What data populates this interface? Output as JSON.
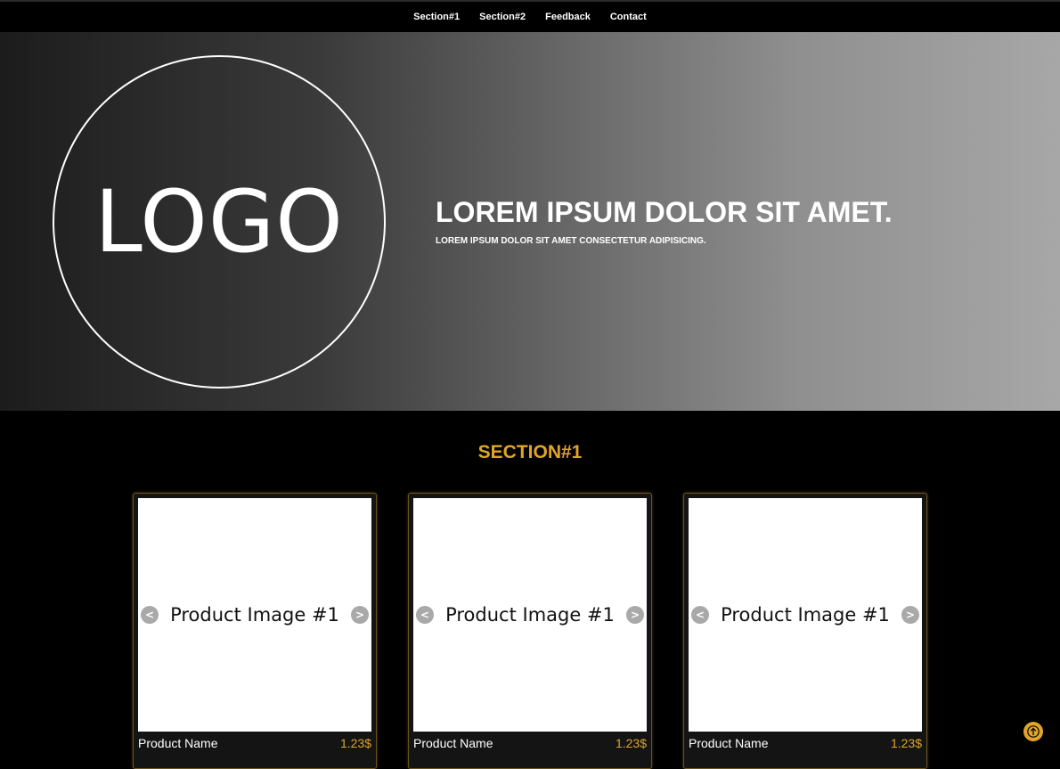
{
  "nav": {
    "items": [
      {
        "label": "Section#1"
      },
      {
        "label": "Section#2"
      },
      {
        "label": "Feedback"
      },
      {
        "label": "Contact"
      }
    ]
  },
  "hero": {
    "logo_text": "LOGO",
    "title": "LOREM IPSUM DOLOR SIT AMET.",
    "subtitle": "LOREM IPSUM DOLOR SIT AMET CONSECTETUR ADIPISICING."
  },
  "section1": {
    "title": "SECTION#1",
    "products": [
      {
        "image_label": "Product Image #1",
        "name": "Product Name",
        "price": "1.23$"
      },
      {
        "image_label": "Product Image #1",
        "name": "Product Name",
        "price": "1.23$"
      },
      {
        "image_label": "Product Image #1",
        "name": "Product Name",
        "price": "1.23$"
      }
    ],
    "prev_symbol": "<",
    "next_symbol": ">"
  },
  "colors": {
    "accent": "#e0a528",
    "background": "#000000",
    "card_border": "#6b5320"
  },
  "icons": {
    "scroll_top": "arrow-up-icon"
  }
}
